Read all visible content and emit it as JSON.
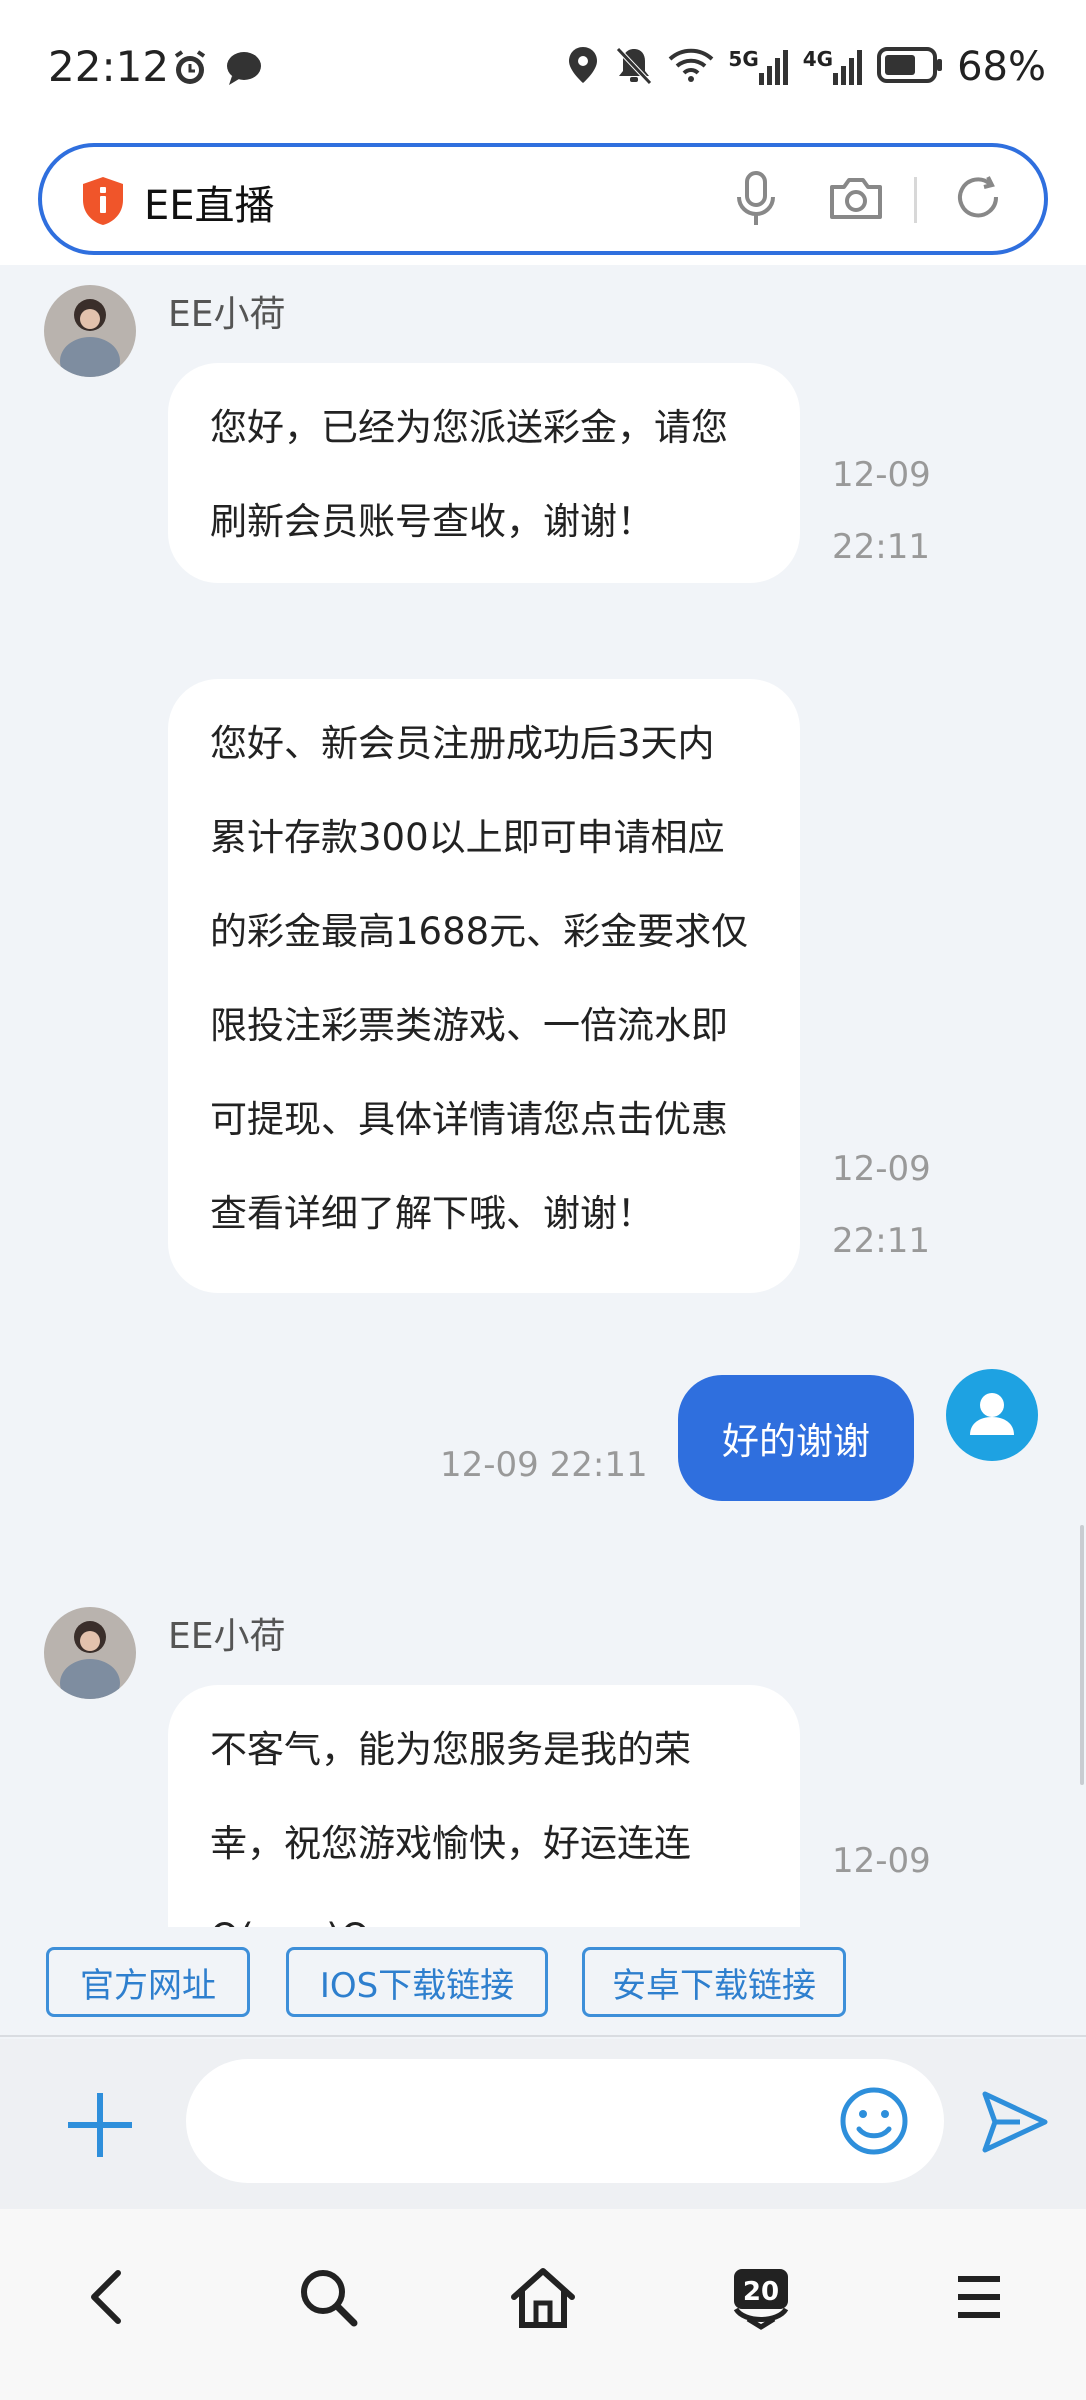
{
  "status_bar": {
    "time": "22:12",
    "network_5g": "5G",
    "network_4g": "4G",
    "battery": "68%"
  },
  "search": {
    "text": "EE直播"
  },
  "messages": [
    {
      "sender": "EE小荷",
      "lines": [
        "您好，已经为您派送彩金，请您",
        "刷新会员账号查收，谢谢！"
      ],
      "date": "12-09",
      "time": "22:11"
    },
    {
      "lines": [
        "您好、新会员注册成功后3天内",
        "累计存款300以上即可申请相应",
        "的彩金最高1688元、彩金要求仅",
        "限投注彩票类游戏、一倍流水即",
        "可提现、具体详情请您点击优惠",
        "查看详细了解下哦、谢谢！"
      ],
      "date": "12-09",
      "time": "22:11"
    },
    {
      "outgoing": true,
      "text": "好的谢谢",
      "timestamp": "12-09 22:11"
    },
    {
      "sender": "EE小荷",
      "lines": [
        "不客气，能为您服务是我的荣",
        "幸，祝您游戏愉快，好运连连",
        "O(∩_∩)O"
      ],
      "date": "12-09"
    }
  ],
  "quick_links": [
    "官方网址",
    "IOS下载链接",
    "安卓下载链接"
  ],
  "colors": {
    "accent": "#2f6fde",
    "link": "#2e7fce",
    "chat_bg": "#f1f4f8"
  }
}
